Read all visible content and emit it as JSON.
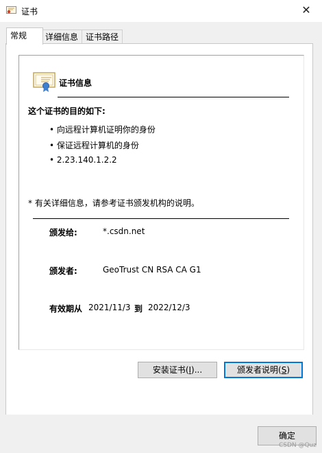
{
  "window": {
    "title": "证书",
    "close_glyph": "✕"
  },
  "tabs": [
    {
      "label": "常规",
      "active": true
    },
    {
      "label": "详细信息",
      "active": false
    },
    {
      "label": "证书路径",
      "active": false
    }
  ],
  "certificate": {
    "heading": "证书信息",
    "purpose_heading": "这个证书的目的如下:",
    "purposes": [
      "向远程计算机证明你的身份",
      "保证远程计算机的身份",
      "2.23.140.1.2.2"
    ],
    "note": "* 有关详细信息，请参考证书颁发机构的说明。",
    "issued_to_label": "颁发给:",
    "issued_to": "*.csdn.net",
    "issued_by_label": "颁发者:",
    "issued_by": "GeoTrust CN RSA CA G1",
    "validity_label": "有效期从",
    "valid_from": "2021/11/3",
    "to_label": "到",
    "valid_to": "2022/12/3"
  },
  "buttons": {
    "install_label": "安装证书(",
    "install_key": "I",
    "install_suffix": ")...",
    "issuer_label": "颁发者说明(",
    "issuer_key": "S",
    "issuer_suffix": ")",
    "ok_label": "确定"
  },
  "watermark": "CSDN @Quz",
  "icons": {
    "title": "certificate-icon",
    "body": "certificate-icon",
    "close": "close-icon"
  }
}
